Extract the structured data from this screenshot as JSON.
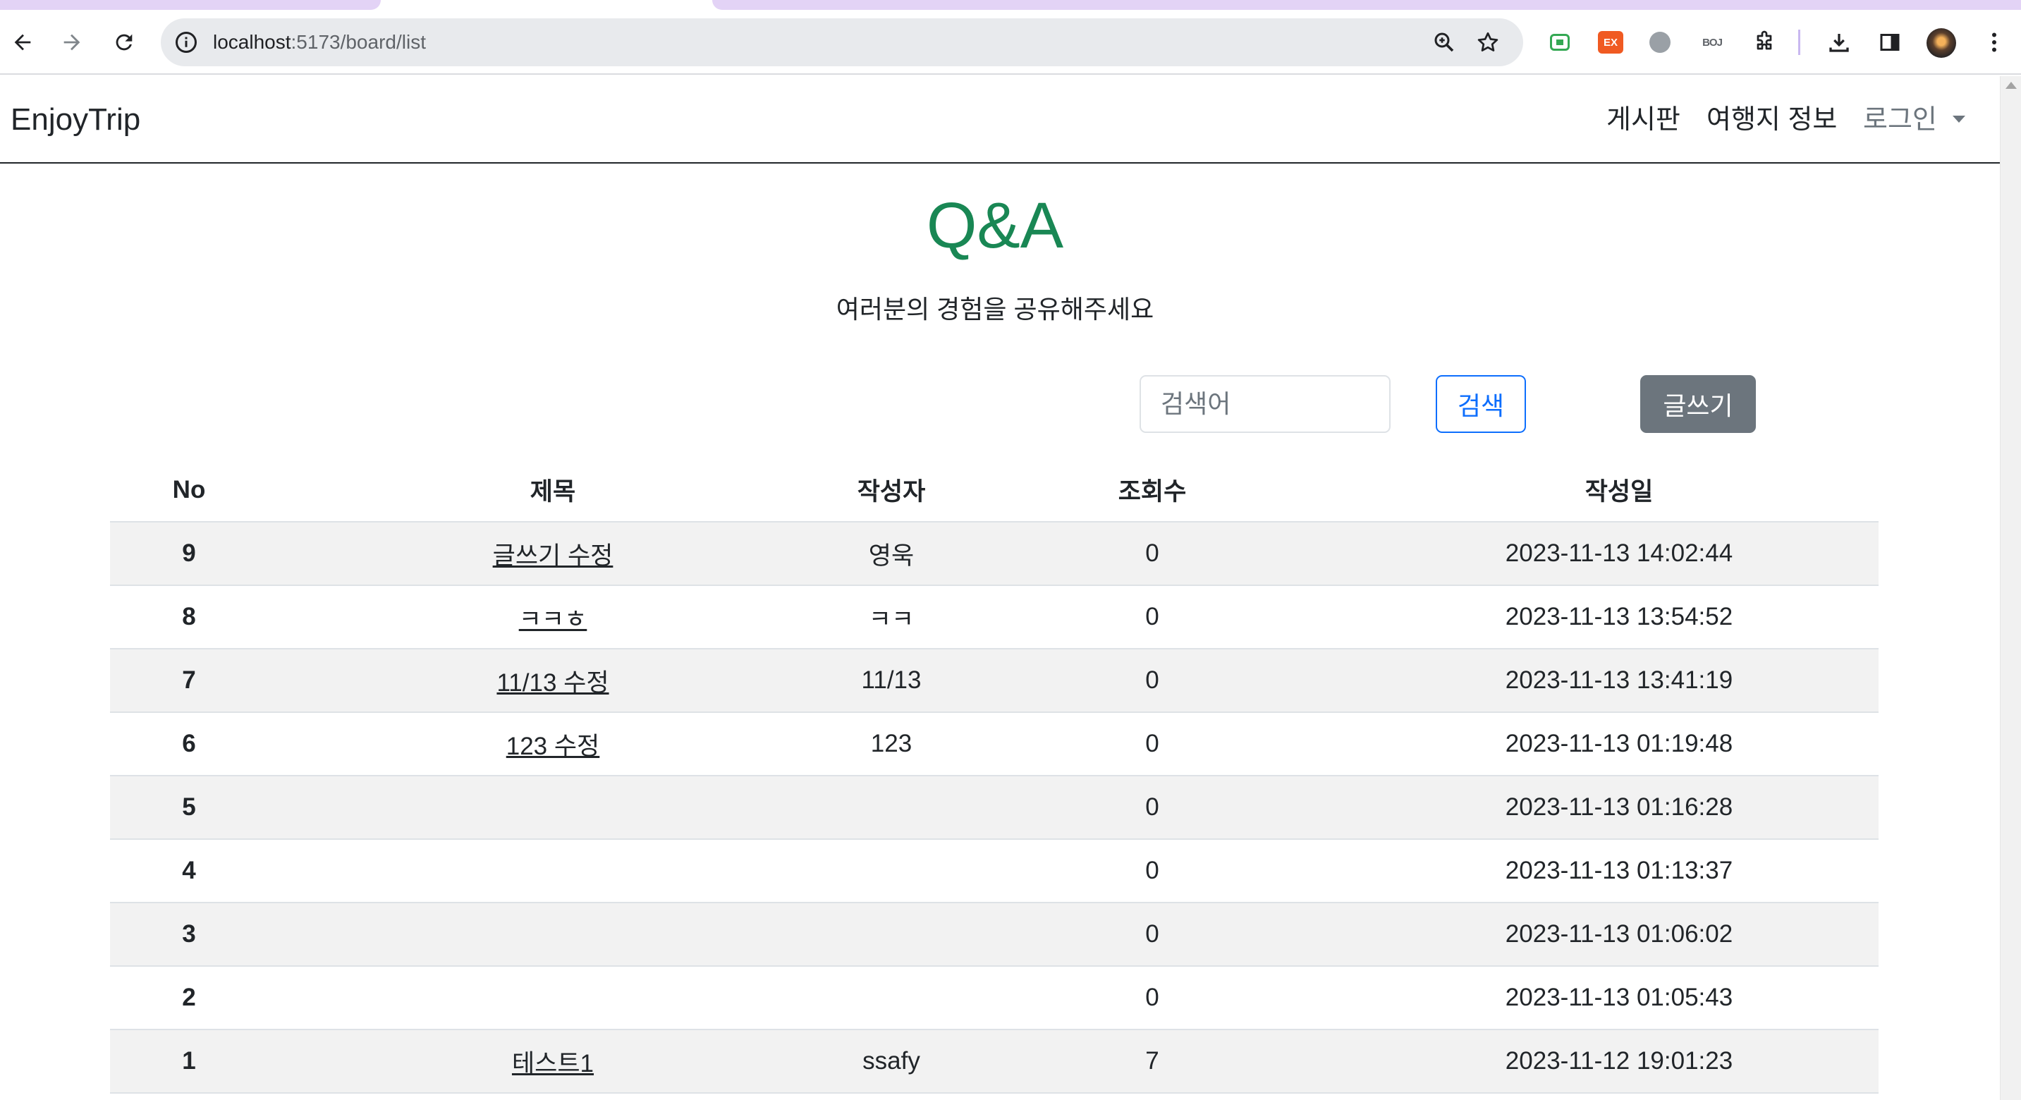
{
  "browser": {
    "url_host": "localhost",
    "url_path": ":5173/board/list"
  },
  "nav": {
    "brand": "EnjoyTrip",
    "links": [
      "게시판",
      "여행지 정보"
    ],
    "login": "로그인"
  },
  "header": {
    "title": "Q&A",
    "subtitle": "여러분의 경험을 공유해주세요"
  },
  "search": {
    "placeholder": "검색어",
    "button_label": "검색",
    "write_label": "글쓰기"
  },
  "table": {
    "columns": [
      "No",
      "제목",
      "작성자",
      "조회수",
      "작성일"
    ],
    "rows": [
      {
        "no": "9",
        "title": "글쓰기 수정",
        "author": "영욱",
        "views": "0",
        "date": "2023-11-13 14:02:44"
      },
      {
        "no": "8",
        "title": "ㅋㅋㅎ",
        "author": "ㅋㅋ",
        "views": "0",
        "date": "2023-11-13 13:54:52"
      },
      {
        "no": "7",
        "title": "11/13 수정",
        "author": "11/13",
        "views": "0",
        "date": "2023-11-13 13:41:19"
      },
      {
        "no": "6",
        "title": "123 수정",
        "author": "123",
        "views": "0",
        "date": "2023-11-13 01:19:48"
      },
      {
        "no": "5",
        "title": "",
        "author": "",
        "views": "0",
        "date": "2023-11-13 01:16:28"
      },
      {
        "no": "4",
        "title": "",
        "author": "",
        "views": "0",
        "date": "2023-11-13 01:13:37"
      },
      {
        "no": "3",
        "title": "",
        "author": "",
        "views": "0",
        "date": "2023-11-13 01:06:02"
      },
      {
        "no": "2",
        "title": "",
        "author": "",
        "views": "0",
        "date": "2023-11-13 01:05:43"
      },
      {
        "no": "1",
        "title": "테스트1",
        "author": "ssafy",
        "views": "7",
        "date": "2023-11-12 19:01:23"
      }
    ]
  },
  "colors": {
    "title_green": "#198754",
    "primary_blue": "#0d6efd",
    "secondary_gray": "#6c757d",
    "stripe": "#f2f2f2"
  },
  "icons": [
    "back-arrow-icon",
    "forward-arrow-icon",
    "reload-icon",
    "info-icon",
    "zoom-icon",
    "star-icon",
    "extensions-puzzle-icon",
    "download-icon",
    "sidepanel-icon",
    "kebab-menu-icon",
    "dropdown-caret-icon"
  ]
}
